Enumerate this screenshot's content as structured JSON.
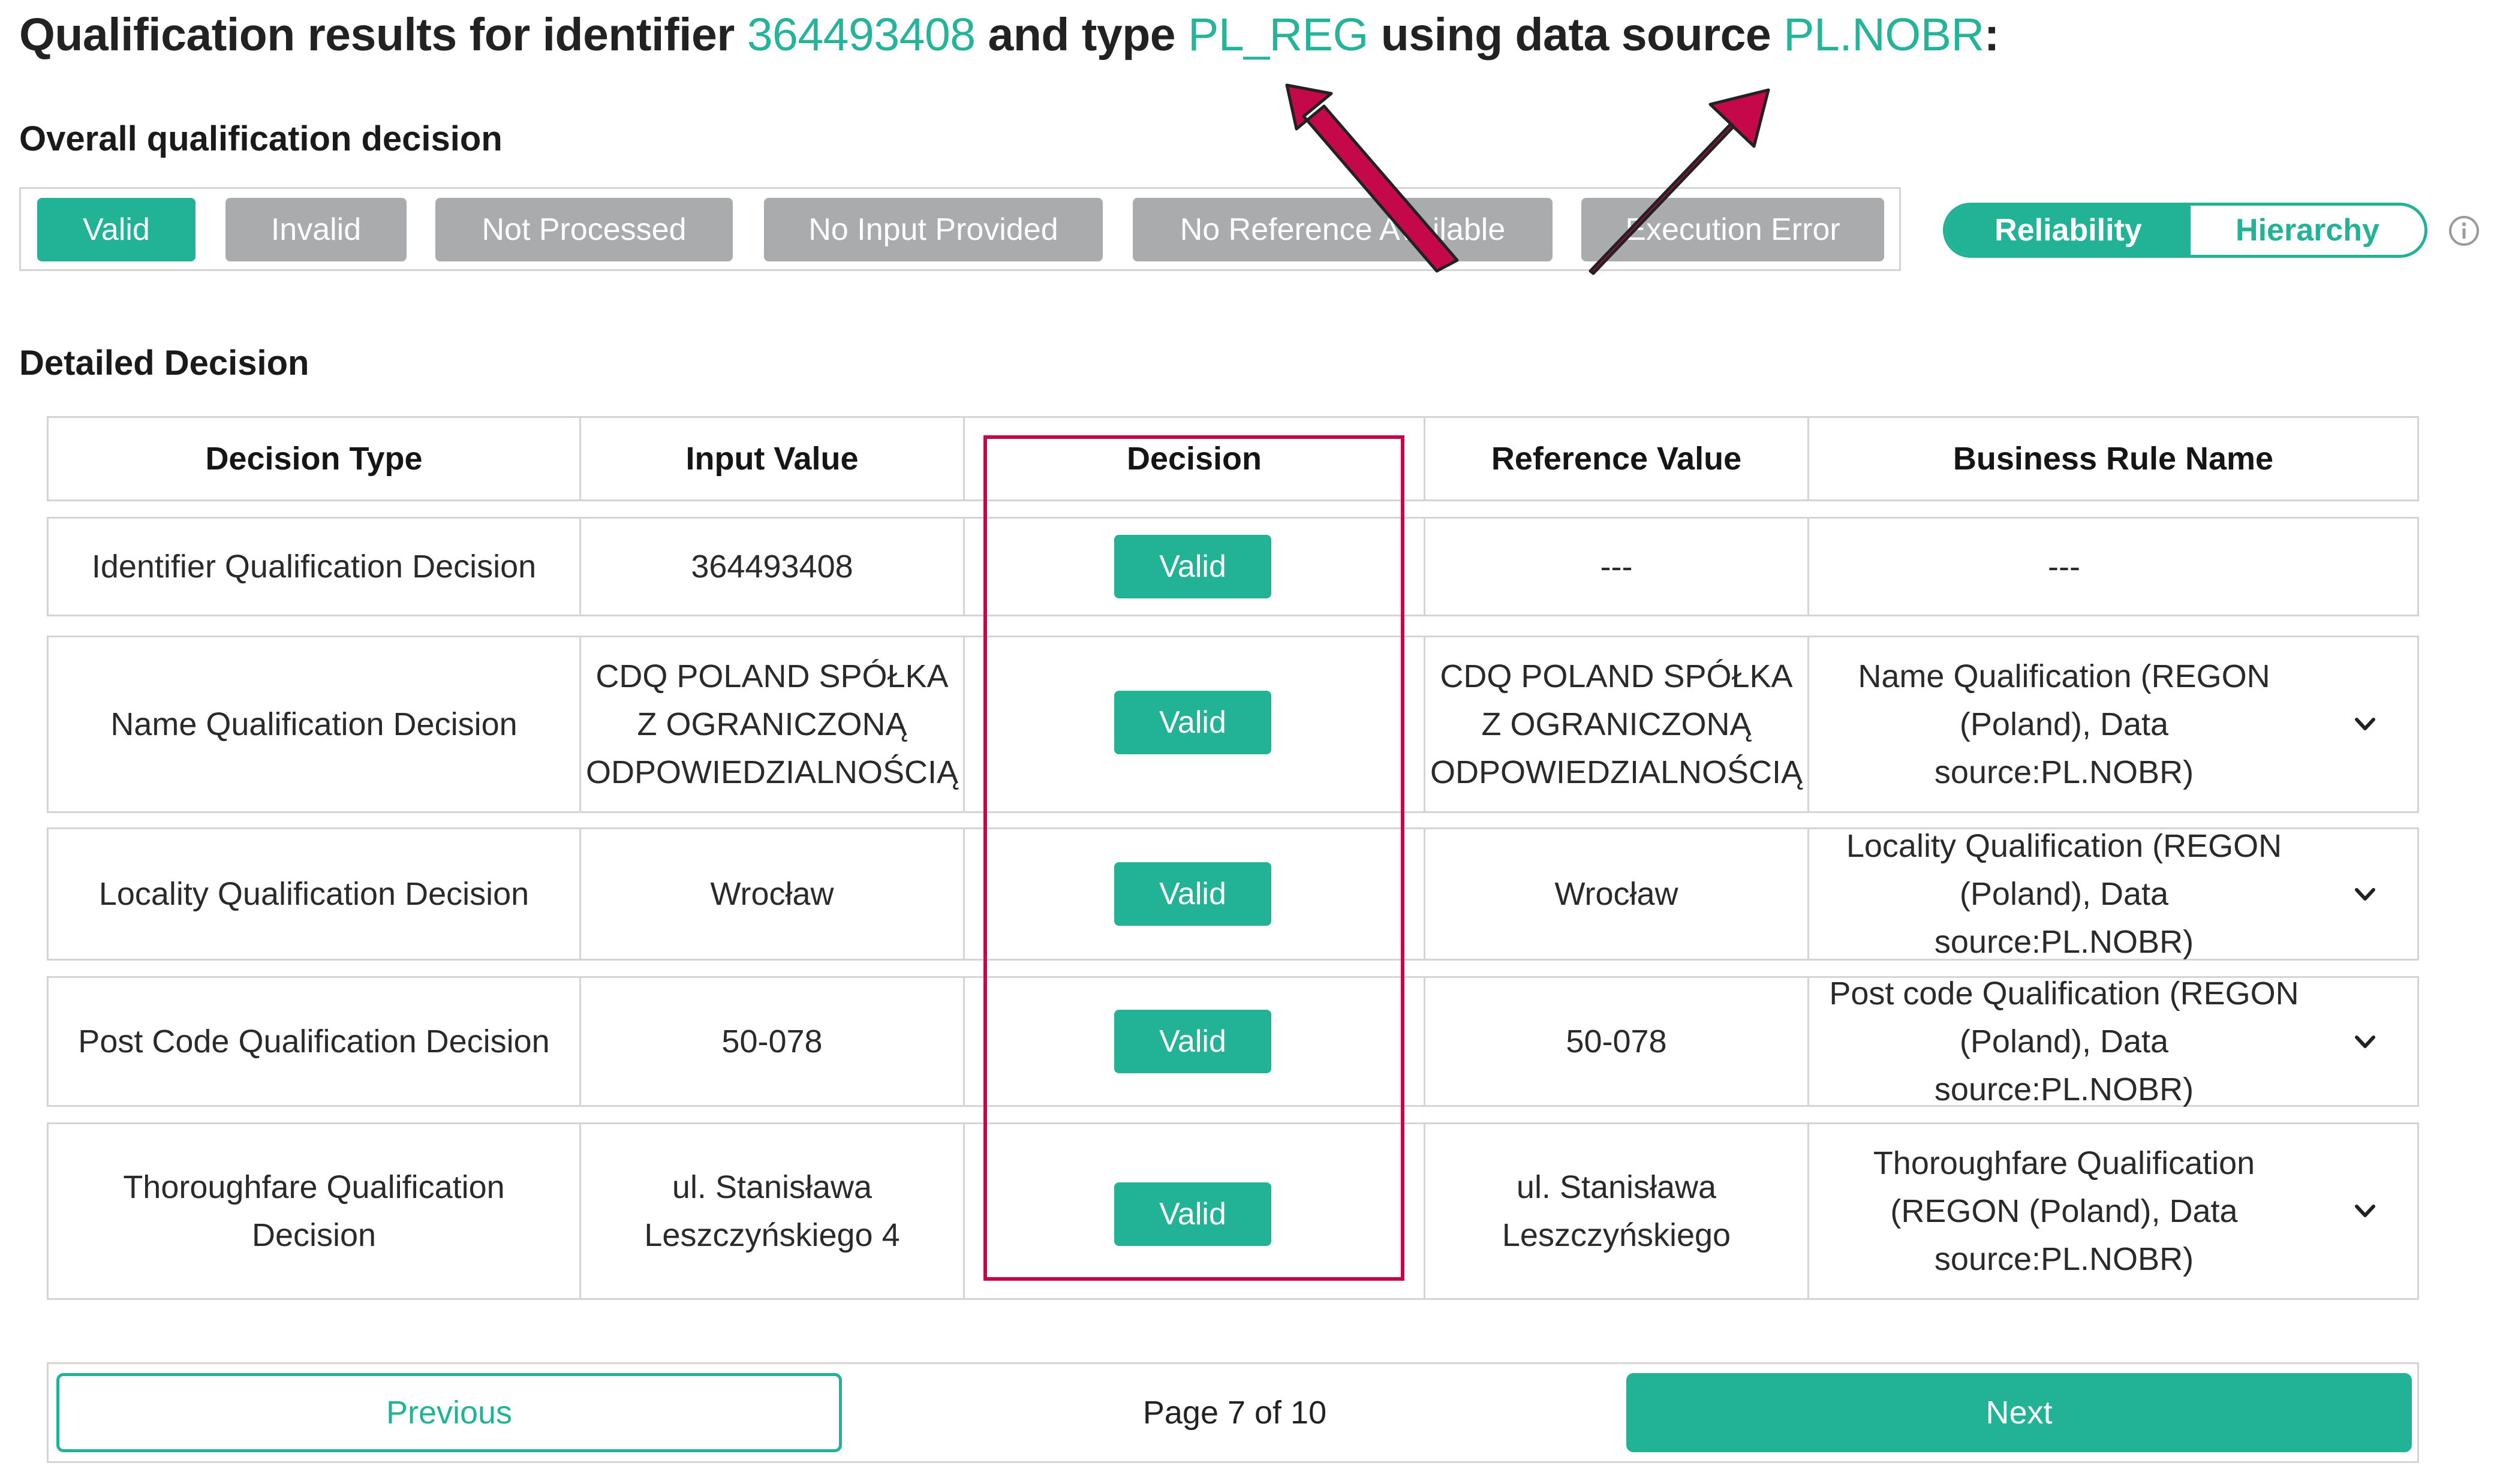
{
  "title": {
    "prefix": "Qualification results for identifier ",
    "identifier": "364493408",
    "type_text": " and type ",
    "type": "PL_REG",
    "source_text": " using data source ",
    "source": "PL.NOBR",
    "suffix": ":"
  },
  "overall": {
    "label": "Overall qualification decision",
    "statuses": [
      "Valid",
      "Invalid",
      "Not Processed",
      "No Input Provided",
      "No Reference Available",
      "Execution Error"
    ],
    "active": "Valid"
  },
  "toggle": {
    "left": "Reliability",
    "right": "Hierarchy",
    "selected": "Reliability"
  },
  "info_icon": "info-icon",
  "detailed": {
    "label": "Detailed Decision",
    "headers": [
      "Decision Type",
      "Input Value",
      "Decision",
      "Reference Value",
      "Business Rule Name"
    ],
    "rows": [
      {
        "type": "Identifier Qualification Decision",
        "input": "364493408",
        "decision": "Valid",
        "reference": "---",
        "rule": "---"
      },
      {
        "type": "Name Qualification Decision",
        "input": "CDQ POLAND SPÓŁKA Z OGRANICZONĄ ODPOWIEDZIALNOŚCIĄ",
        "decision": "Valid",
        "reference": "CDQ POLAND SPÓŁKA Z OGRANICZONĄ ODPOWIEDZIALNOŚCIĄ",
        "rule": "Name Qualification (REGON (Poland), Data source:PL.NOBR)"
      },
      {
        "type": "Locality Qualification Decision",
        "input": "Wrocław",
        "decision": "Valid",
        "reference": "Wrocław",
        "rule": "Locality Qualification (REGON (Poland), Data source:PL.NOBR)"
      },
      {
        "type": "Post Code Qualification Decision",
        "input": "50-078",
        "decision": "Valid",
        "reference": "50-078",
        "rule": "Post code Qualification (REGON (Poland), Data source:PL.NOBR)"
      },
      {
        "type": "Thoroughfare Qualification Decision",
        "input": "ul. Stanisława Leszczyńskiego 4",
        "decision": "Valid",
        "reference": "ul. Stanisława Leszczyńskiego",
        "rule": "Thoroughfare Qualification (REGON (Poland), Data source:PL.NOBR)"
      }
    ]
  },
  "pagination": {
    "previous": "Previous",
    "page": "Page 7 of 10",
    "next": "Next"
  },
  "colors": {
    "accent": "#22b397",
    "inactive": "#a9abad",
    "annotation": "#c5084a",
    "border": "#d4d4d4"
  }
}
